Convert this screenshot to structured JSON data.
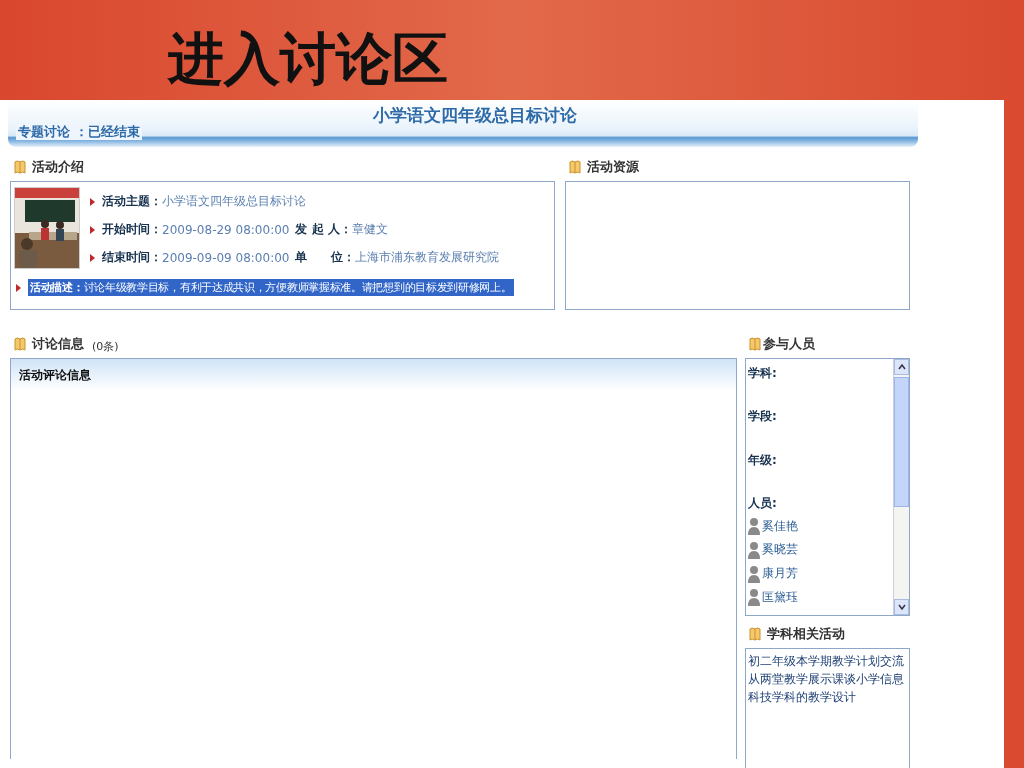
{
  "slide_title": "进入讨论区",
  "header": {
    "title": "小学语文四年级总目标讨论",
    "status_label": "专题讨论",
    "status": "：已经结束"
  },
  "intro": {
    "heading": "活动介绍",
    "rows": [
      {
        "label": "活动主题：",
        "value": "小学语文四年级总目标讨论"
      },
      {
        "label": "开始时间：",
        "value": "2009-08-29 08:00:00",
        "extra_label": "发 起 人：",
        "extra_value": "章健文"
      },
      {
        "label": "结束时间：",
        "value": "2009-09-09 08:00:00",
        "extra_label": "单　　位：",
        "extra_value": "上海市浦东教育发展研究院"
      }
    ],
    "description": {
      "label": "活动描述：",
      "value": "讨论年级教学目标，有利于达成共识，方便教师掌握标准。请把想到的目标发到研修网上。",
      "highlighted": true
    }
  },
  "resources": {
    "heading": "活动资源"
  },
  "discussion": {
    "heading": "讨论信息",
    "count": "(0条)",
    "table_header": "活动评论信息"
  },
  "participants": {
    "heading": "参与人员",
    "fields": [
      "学科:",
      "学段:",
      "年级:",
      "人员:"
    ],
    "people": [
      "奚佳艳",
      "奚晓芸",
      "康月芳",
      "匡黛珏"
    ]
  },
  "related": {
    "heading": "学科相关活动",
    "items": [
      "初二年级本学期教学计划交流",
      "从两堂教学展示课谈小学信息科技学科的教学设计"
    ]
  }
}
